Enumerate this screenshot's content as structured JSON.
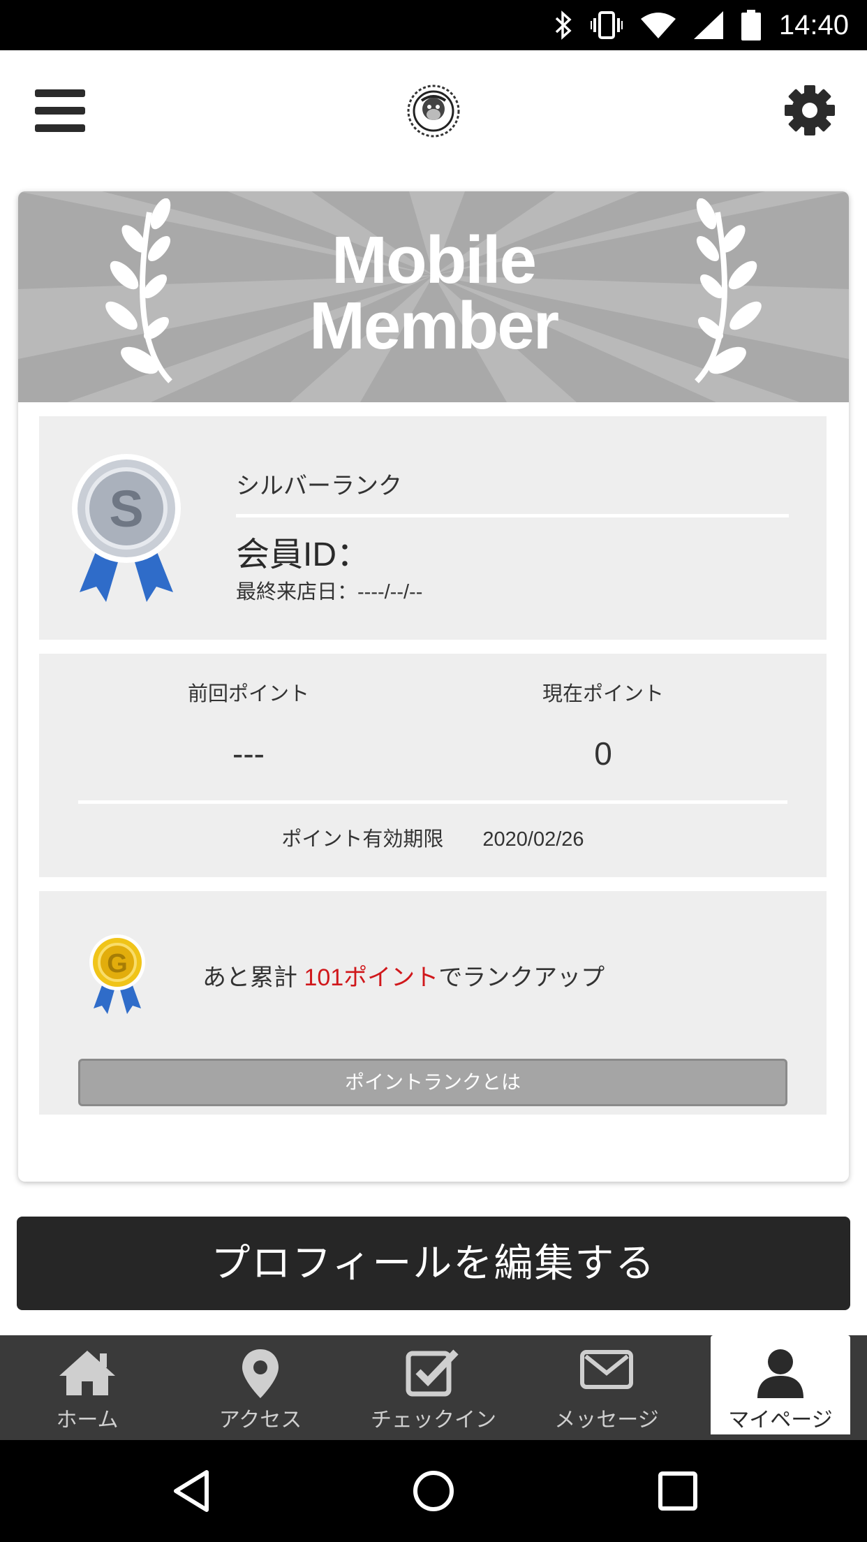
{
  "status_bar": {
    "time": "14:40"
  },
  "header": {
    "menu_icon": "hamburger-menu-icon",
    "logo_icon": "monkey-crest-logo",
    "settings_icon": "gear-icon"
  },
  "card": {
    "banner_title_line1": "Mobile",
    "banner_title_line2": "Member",
    "rank": {
      "badge_letter": "S",
      "name": "シルバーランク",
      "member_id_label": "会員ID：",
      "last_visit": "最終来店日：----/--/--"
    },
    "points": {
      "previous_label": "前回ポイント",
      "previous_value": "---",
      "current_label": "現在ポイント",
      "current_value": "0",
      "expiry_label": "ポイント有効期限",
      "expiry_date": "2020/02/26"
    },
    "next_rank": {
      "badge_letter": "G",
      "text_before": "あと累計 ",
      "text_highlight": "101ポイント",
      "text_after": "でランクアップ",
      "button_label": "ポイントランクとは"
    }
  },
  "edit_profile_label": "プロフィールを編集する",
  "tabs": [
    {
      "label": "ホーム",
      "icon": "home-icon"
    },
    {
      "label": "アクセス",
      "icon": "map-pin-icon"
    },
    {
      "label": "チェックイン",
      "icon": "checkbox-icon"
    },
    {
      "label": "メッセージ",
      "icon": "envelope-icon"
    },
    {
      "label": "マイページ",
      "icon": "user-icon",
      "active": true
    }
  ],
  "colors": {
    "highlight_red": "#d0171b",
    "edit_button_bg": "#262626",
    "tabbar_bg": "#3a3a3a",
    "banner_bg": "#a9a9a9",
    "panel_bg": "#eeeeee"
  }
}
